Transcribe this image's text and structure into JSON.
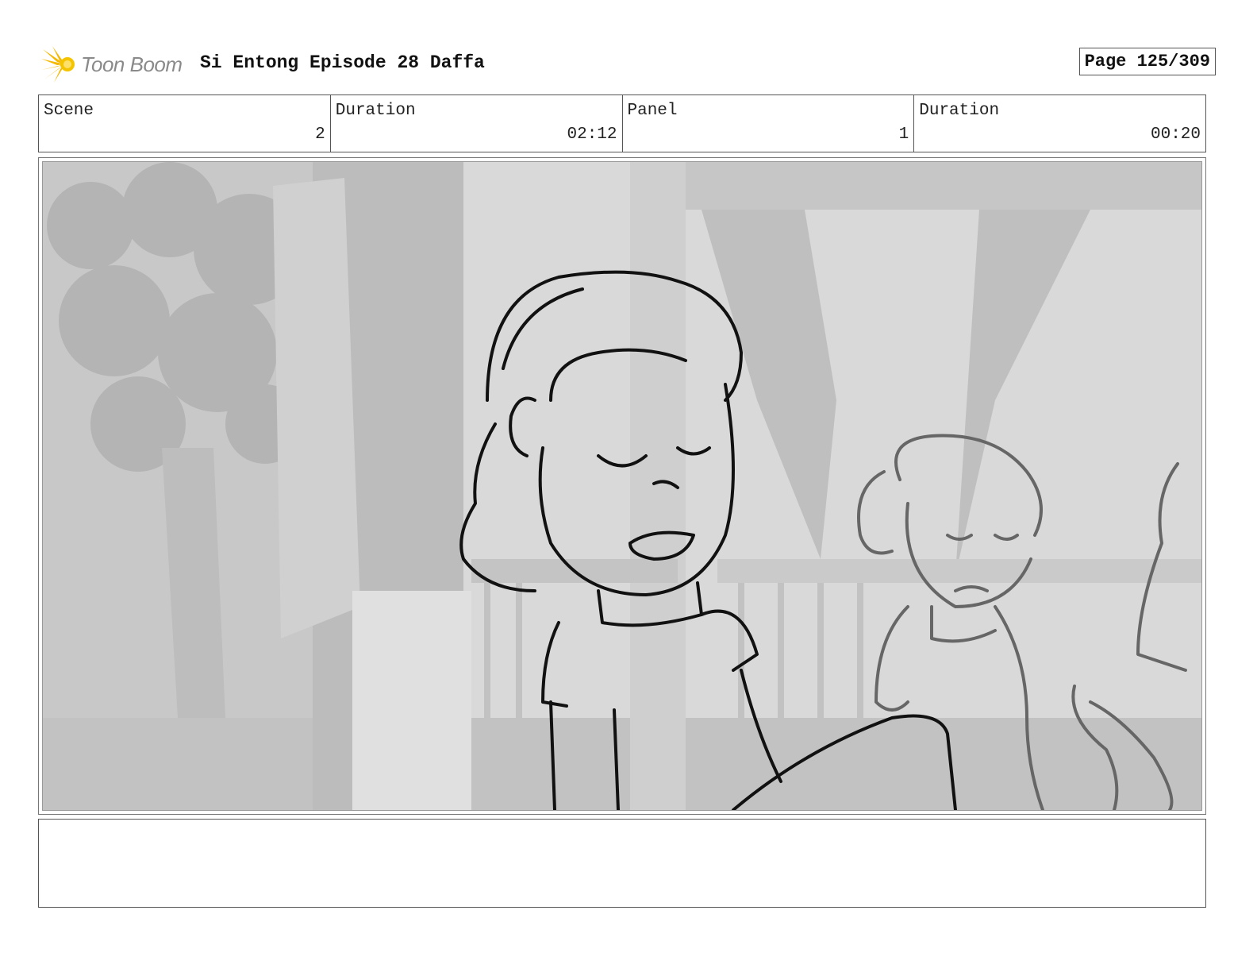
{
  "header": {
    "logo_text": "Toon Boom",
    "title": "Si Entong Episode 28 Daffa",
    "page": "Page 125/309"
  },
  "info": {
    "scene_label": "Scene",
    "scene_value": "2",
    "scene_duration_label": "Duration",
    "scene_duration_value": "02:12",
    "panel_label": "Panel",
    "panel_value": "1",
    "panel_duration_label": "Duration",
    "panel_duration_value": "00:20"
  },
  "notes": {
    "text": ""
  }
}
